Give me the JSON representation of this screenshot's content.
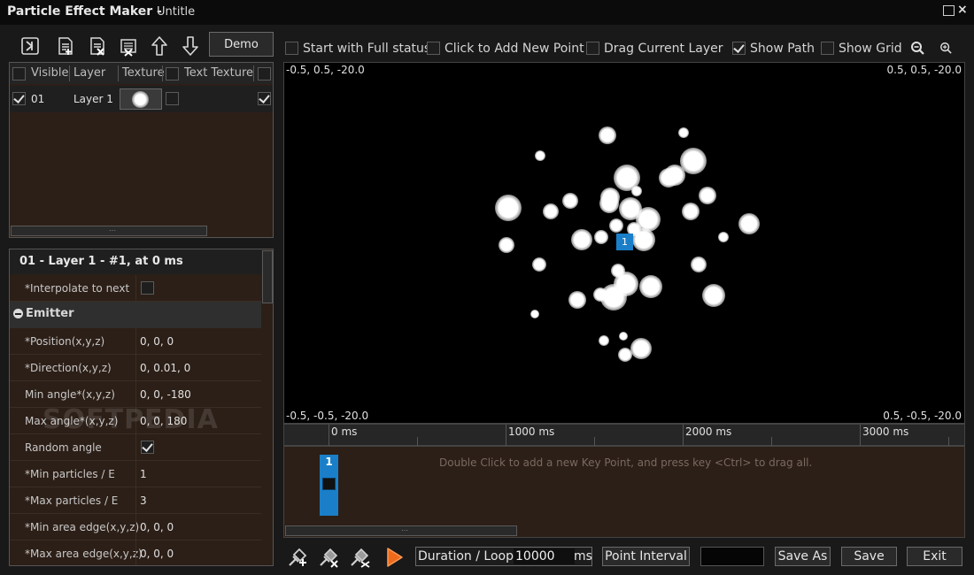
{
  "window": {
    "app_title": "Particle Effect Maker -",
    "doc_title": "Untitle"
  },
  "toolbar": {
    "icons": [
      "export-icon",
      "new-layer-icon",
      "delete-layer-icon",
      "clear-layers-icon",
      "move-up-icon",
      "move-down-icon"
    ],
    "demo_label": "Demo"
  },
  "options": {
    "start_full_status": {
      "label": "Start with Full status",
      "checked": false
    },
    "click_add_point": {
      "label": "Click to Add New Point",
      "checked": false
    },
    "drag_layer": {
      "label": "Drag Current Layer",
      "checked": false
    },
    "show_path": {
      "label": "Show Path",
      "checked": true
    },
    "show_grid": {
      "label": "Show Grid",
      "checked": false
    }
  },
  "layers": {
    "columns": [
      "Visible",
      "Layer",
      "Texture",
      "Text Texture"
    ],
    "rows": [
      {
        "id": "01",
        "name": "Layer 1",
        "visible": true,
        "text_texture": false,
        "last": true
      }
    ]
  },
  "props": {
    "header": "01 - Layer 1 - #1, at 0 ms",
    "interpolate_label": "*Interpolate to next",
    "section": "Emitter",
    "rows": [
      {
        "label": "*Position(x,y,z)",
        "value": "0, 0, 0"
      },
      {
        "label": "*Direction(x,y,z)",
        "value": "0, 0.01, 0"
      },
      {
        "label": "Min angle*(x,y,z)",
        "value": "0, 0, -180"
      },
      {
        "label": "Max angle*(x,y,z)",
        "value": "0, 0, 180"
      },
      {
        "label": "Random angle",
        "value": ""
      },
      {
        "label": "*Min particles / E",
        "value": "1"
      },
      {
        "label": "*Max particles / E",
        "value": "3"
      },
      {
        "label": "*Min area edge(x,y,z)",
        "value": "0, 0, 0"
      },
      {
        "label": "*Max area edge(x,y,z)",
        "value": "0, 0, 0"
      }
    ]
  },
  "viewport": {
    "top_left": "-0.5, 0.5, -20.0",
    "top_right": "0.5, 0.5, -20.0",
    "bottom_left": "-0.5, -0.5, -20.0",
    "bottom_right": "0.5, -0.5, -20.0",
    "keypoint_label": "1"
  },
  "timeline": {
    "labels": [
      "0 ms",
      "1000 ms",
      "2000 ms",
      "3000 ms"
    ],
    "hint": "Double Click to add a new Key Point, and press key <Ctrl> to drag all.",
    "keypoint_number": "1"
  },
  "bottom": {
    "duration_label": "Duration / Loop =",
    "duration_value": "10000",
    "duration_unit": "ms",
    "point_interval": "Point Interval",
    "save_as": "Save As",
    "save": "Save",
    "exit": "Exit"
  },
  "watermark": "SOFTPEDIA",
  "colors": {
    "accent": "#1a7fc8",
    "play": "#f06a1c",
    "panel": "#2c1f17"
  }
}
